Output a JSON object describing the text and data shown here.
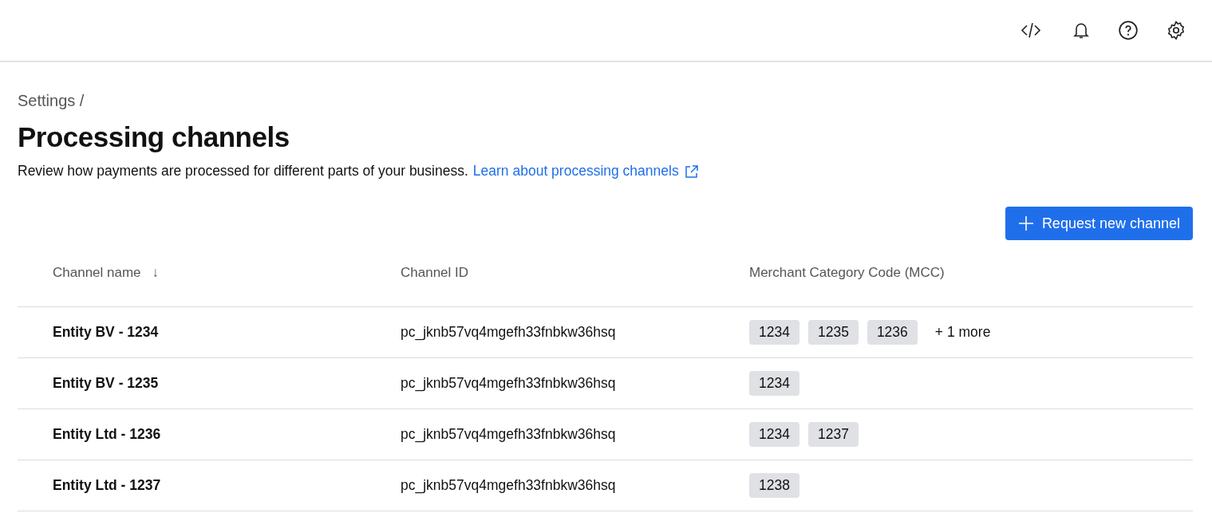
{
  "breadcrumb": "Settings /",
  "title": "Processing channels",
  "description": "Review how payments are processed for different parts of your business.",
  "learn_link": "Learn about processing channels",
  "request_button": "Request new channel",
  "table": {
    "columns": [
      {
        "label": "Channel name",
        "sort_indicator": "↓"
      },
      {
        "label": "Channel ID"
      },
      {
        "label": "Merchant Category Code (MCC)"
      }
    ],
    "rows": [
      {
        "name": "Entity BV - 1234",
        "channel_id": "pc_jknb57vq4mgefh33fnbkw36hsq",
        "mcc": [
          "1234",
          "1235",
          "1236"
        ],
        "more": "+ 1 more"
      },
      {
        "name": "Entity BV - 1235",
        "channel_id": "pc_jknb57vq4mgefh33fnbkw36hsq",
        "mcc": [
          "1234"
        ]
      },
      {
        "name": "Entity Ltd - 1236",
        "channel_id": "pc_jknb57vq4mgefh33fnbkw36hsq",
        "mcc": [
          "1234",
          "1237"
        ]
      },
      {
        "name": "Entity Ltd - 1237",
        "channel_id": "pc_jknb57vq4mgefh33fnbkw36hsq",
        "mcc": [
          "1238"
        ]
      }
    ]
  }
}
